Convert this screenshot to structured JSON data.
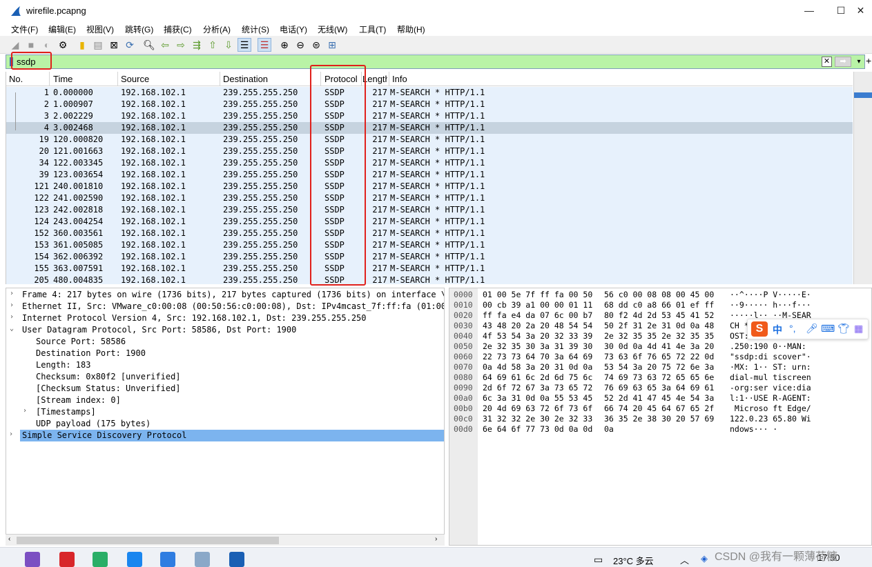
{
  "window": {
    "title": "wirefile.pcapng"
  },
  "menu": [
    "文件(F)",
    "编辑(E)",
    "视图(V)",
    "跳转(G)",
    "捕获(C)",
    "分析(A)",
    "统计(S)",
    "电话(Y)",
    "无线(W)",
    "工具(T)",
    "帮助(H)"
  ],
  "filter": {
    "value": "ssdp"
  },
  "columns": [
    "No.",
    "Time",
    "Source",
    "Destination",
    "Protocol",
    "Length",
    "Info"
  ],
  "packets": [
    {
      "no": "1",
      "time": "0.000000",
      "src": "192.168.102.1",
      "dst": "239.255.255.250",
      "proto": "SSDP",
      "len": "217",
      "info": "M-SEARCH * HTTP/1.1"
    },
    {
      "no": "2",
      "time": "1.000907",
      "src": "192.168.102.1",
      "dst": "239.255.255.250",
      "proto": "SSDP",
      "len": "217",
      "info": "M-SEARCH * HTTP/1.1"
    },
    {
      "no": "3",
      "time": "2.002229",
      "src": "192.168.102.1",
      "dst": "239.255.255.250",
      "proto": "SSDP",
      "len": "217",
      "info": "M-SEARCH * HTTP/1.1"
    },
    {
      "no": "4",
      "time": "3.002468",
      "src": "192.168.102.1",
      "dst": "239.255.255.250",
      "proto": "SSDP",
      "len": "217",
      "info": "M-SEARCH * HTTP/1.1"
    },
    {
      "no": "19",
      "time": "120.000820",
      "src": "192.168.102.1",
      "dst": "239.255.255.250",
      "proto": "SSDP",
      "len": "217",
      "info": "M-SEARCH * HTTP/1.1"
    },
    {
      "no": "20",
      "time": "121.001663",
      "src": "192.168.102.1",
      "dst": "239.255.255.250",
      "proto": "SSDP",
      "len": "217",
      "info": "M-SEARCH * HTTP/1.1"
    },
    {
      "no": "34",
      "time": "122.003345",
      "src": "192.168.102.1",
      "dst": "239.255.255.250",
      "proto": "SSDP",
      "len": "217",
      "info": "M-SEARCH * HTTP/1.1"
    },
    {
      "no": "39",
      "time": "123.003654",
      "src": "192.168.102.1",
      "dst": "239.255.255.250",
      "proto": "SSDP",
      "len": "217",
      "info": "M-SEARCH * HTTP/1.1"
    },
    {
      "no": "121",
      "time": "240.001810",
      "src": "192.168.102.1",
      "dst": "239.255.255.250",
      "proto": "SSDP",
      "len": "217",
      "info": "M-SEARCH * HTTP/1.1"
    },
    {
      "no": "122",
      "time": "241.002590",
      "src": "192.168.102.1",
      "dst": "239.255.255.250",
      "proto": "SSDP",
      "len": "217",
      "info": "M-SEARCH * HTTP/1.1"
    },
    {
      "no": "123",
      "time": "242.002818",
      "src": "192.168.102.1",
      "dst": "239.255.255.250",
      "proto": "SSDP",
      "len": "217",
      "info": "M-SEARCH * HTTP/1.1"
    },
    {
      "no": "124",
      "time": "243.004254",
      "src": "192.168.102.1",
      "dst": "239.255.255.250",
      "proto": "SSDP",
      "len": "217",
      "info": "M-SEARCH * HTTP/1.1"
    },
    {
      "no": "152",
      "time": "360.003561",
      "src": "192.168.102.1",
      "dst": "239.255.255.250",
      "proto": "SSDP",
      "len": "217",
      "info": "M-SEARCH * HTTP/1.1"
    },
    {
      "no": "153",
      "time": "361.005085",
      "src": "192.168.102.1",
      "dst": "239.255.255.250",
      "proto": "SSDP",
      "len": "217",
      "info": "M-SEARCH * HTTP/1.1"
    },
    {
      "no": "154",
      "time": "362.006392",
      "src": "192.168.102.1",
      "dst": "239.255.255.250",
      "proto": "SSDP",
      "len": "217",
      "info": "M-SEARCH * HTTP/1.1"
    },
    {
      "no": "155",
      "time": "363.007591",
      "src": "192.168.102.1",
      "dst": "239.255.255.250",
      "proto": "SSDP",
      "len": "217",
      "info": "M-SEARCH * HTTP/1.1"
    },
    {
      "no": "205",
      "time": "480.004835",
      "src": "192.168.102.1",
      "dst": "239.255.255.250",
      "proto": "SSDP",
      "len": "217",
      "info": "M-SEARCH * HTTP/1.1"
    }
  ],
  "details": [
    {
      "arrow": "›",
      "text": "Frame 4: 217 bytes on wire (1736 bits), 217 bytes captured (1736 bits) on interface \\Dev"
    },
    {
      "arrow": "›",
      "text": "Ethernet II, Src: VMware_c0:00:08 (00:50:56:c0:00:08), Dst: IPv4mcast_7f:ff:fa (01:00:5e"
    },
    {
      "arrow": "›",
      "text": "Internet Protocol Version 4, Src: 192.168.102.1, Dst: 239.255.255.250"
    },
    {
      "arrow": "⌄",
      "text": "User Datagram Protocol, Src Port: 58586, Dst Port: 1900"
    },
    {
      "arrow": "",
      "text": "Source Port: 58586"
    },
    {
      "arrow": "",
      "text": "Destination Port: 1900"
    },
    {
      "arrow": "",
      "text": "Length: 183"
    },
    {
      "arrow": "",
      "text": "Checksum: 0x80f2 [unverified]"
    },
    {
      "arrow": "",
      "text": "[Checksum Status: Unverified]"
    },
    {
      "arrow": "",
      "text": "[Stream index: 0]"
    },
    {
      "arrow": "›",
      "text": "[Timestamps]"
    },
    {
      "arrow": "",
      "text": "UDP payload (175 bytes)"
    },
    {
      "arrow": "›",
      "text": "Simple Service Discovery Protocol"
    }
  ],
  "bytes": [
    {
      "off": "0000",
      "hex1": "01 00 5e 7f ff fa 00 50",
      "hex2": "56 c0 00 08 08 00 45 00",
      "ascii": "··^····P V·····E·"
    },
    {
      "off": "0010",
      "hex1": "00 cb 39 a1 00 00 01 11",
      "hex2": "68 dd c0 a8 66 01 ef ff",
      "ascii": "··9····· h···f···"
    },
    {
      "off": "0020",
      "hex1": "ff fa e4 da 07 6c 00 b7",
      "hex2": "80 f2 4d 2d 53 45 41 52",
      "ascii": "·····l·· ··M-SEAR"
    },
    {
      "off": "0030",
      "hex1": "43 48 20 2a 20 48 54 54",
      "hex2": "50 2f 31 2e 31 0d 0a 48",
      "ascii": "CH * HTT P/1.1··H"
    },
    {
      "off": "0040",
      "hex1": "4f 53 54 3a 20 32 33 39",
      "hex2": "2e 32 35 35 2e 32 35 35",
      "ascii": "OST: 239 .255.255"
    },
    {
      "off": "0050",
      "hex1": "2e 32 35 30 3a 31 39 30",
      "hex2": "30 0d 0a 4d 41 4e 3a 20",
      "ascii": ".250:190 0··MAN: "
    },
    {
      "off": "0060",
      "hex1": "22 73 73 64 70 3a 64 69",
      "hex2": "73 63 6f 76 65 72 22 0d",
      "ascii": "\"ssdp:di scover\"·"
    },
    {
      "off": "0070",
      "hex1": "0a 4d 58 3a 20 31 0d 0a",
      "hex2": "53 54 3a 20 75 72 6e 3a",
      "ascii": "·MX: 1·· ST: urn:"
    },
    {
      "off": "0080",
      "hex1": "64 69 61 6c 2d 6d 75 6c",
      "hex2": "74 69 73 63 72 65 65 6e",
      "ascii": "dial-mul tiscreen"
    },
    {
      "off": "0090",
      "hex1": "2d 6f 72 67 3a 73 65 72",
      "hex2": "76 69 63 65 3a 64 69 61",
      "ascii": "-org:ser vice:dia"
    },
    {
      "off": "00a0",
      "hex1": "6c 3a 31 0d 0a 55 53 45",
      "hex2": "52 2d 41 47 45 4e 54 3a",
      "ascii": "l:1··USE R-AGENT:"
    },
    {
      "off": "00b0",
      "hex1": "20 4d 69 63 72 6f 73 6f",
      "hex2": "66 74 20 45 64 67 65 2f",
      "ascii": " Microso ft Edge/"
    },
    {
      "off": "00c0",
      "hex1": "31 32 32 2e 30 2e 32 33",
      "hex2": "36 35 2e 38 30 20 57 69",
      "ascii": "122.0.23 65.80 Wi"
    },
    {
      "off": "00d0",
      "hex1": "6e 64 6f 77 73 0d 0a 0d",
      "hex2": "0a",
      "ascii": "ndows··· ·"
    }
  ],
  "ime": {
    "logo": "S",
    "lang": "中"
  },
  "taskbar": {
    "weather": "23°C 多云",
    "time": "17:50",
    "watermark": "CSDN @我有一颗薄荷糖"
  },
  "colors": {
    "filter_bg": "#b9f3a6",
    "row_bg": "#e7f1fc",
    "selected_row": "#c6d3df",
    "detail_selected": "#7cb4ef",
    "annotation": "#e0201b"
  }
}
